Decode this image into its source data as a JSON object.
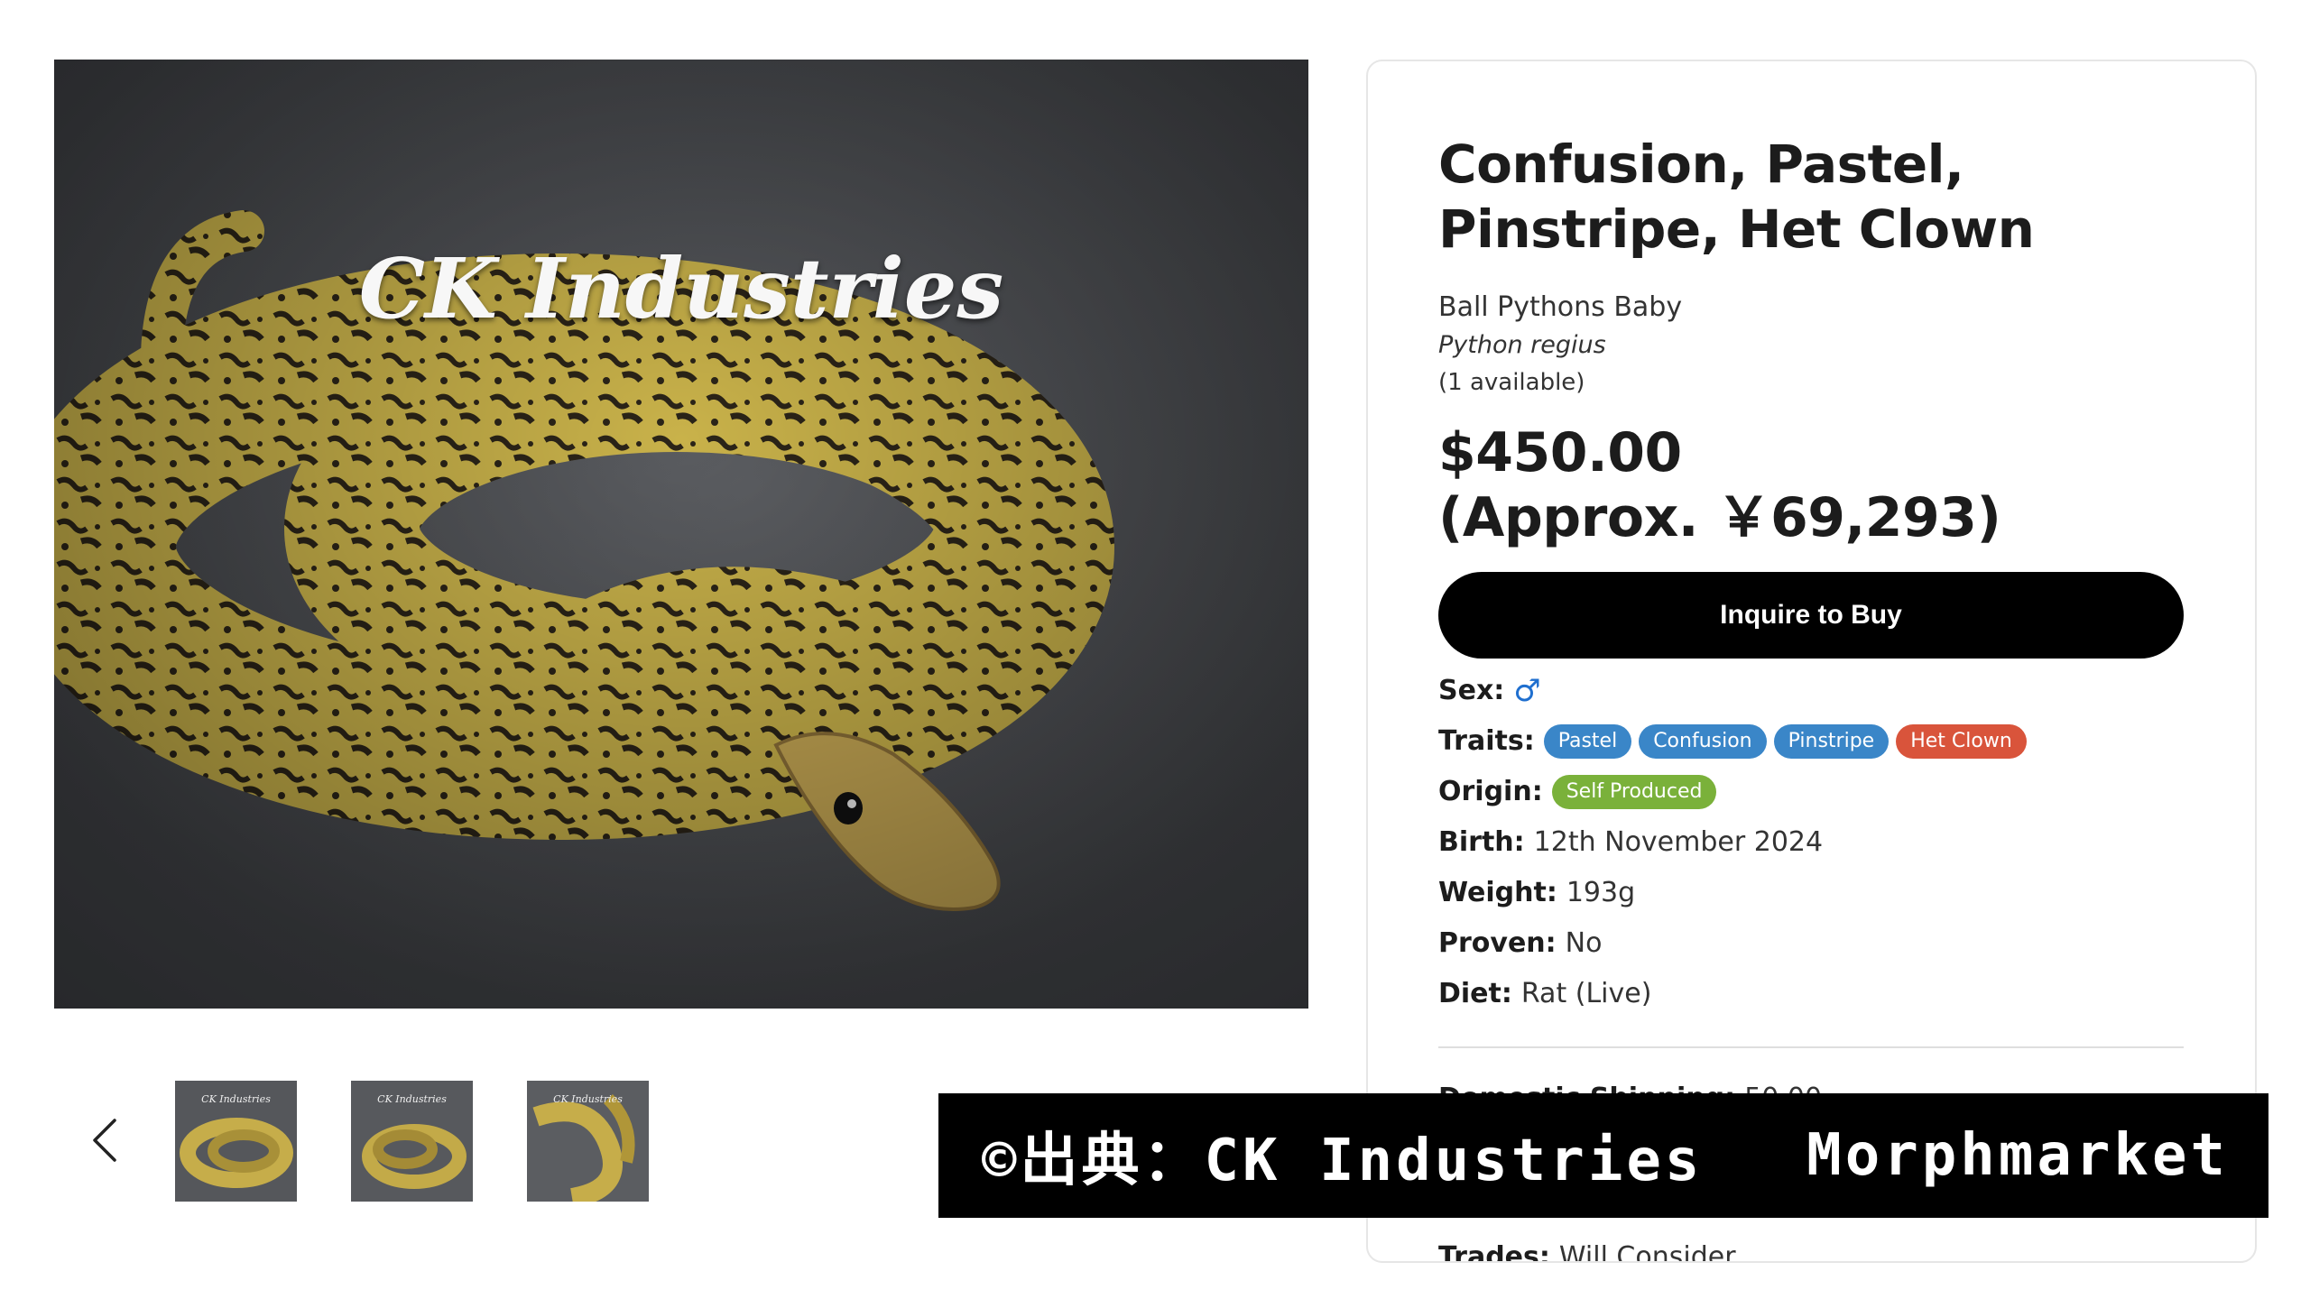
{
  "gallery": {
    "watermark": "CK Industries",
    "thumbnails": [
      {
        "label": "CK Industries"
      },
      {
        "label": "CK Industries"
      },
      {
        "label": "CK Industries"
      }
    ],
    "prev_icon": "chevron-left-icon"
  },
  "product": {
    "title": "Confusion, Pastel, Pinstripe, Het Clown",
    "category": "Ball Pythons Baby",
    "latin_name": "Python regius",
    "availability": "(1 available)",
    "price": "$450.00",
    "price_approx": "(Approx. ￥69,293)",
    "buy_label": "Inquire to Buy",
    "sex_label": "Sex:",
    "sex_icon": "male-icon",
    "sex_glyph": "♂",
    "traits_label": "Traits:",
    "traits": [
      {
        "name": "Pastel",
        "color": "#3a86c8"
      },
      {
        "name": "Confusion",
        "color": "#3a86c8"
      },
      {
        "name": "Pinstripe",
        "color": "#3a86c8"
      },
      {
        "name": "Het Clown",
        "color": "#d9543b"
      }
    ],
    "origin_label": "Origin:",
    "origin": {
      "name": "Self Produced",
      "color": "#7ab13a"
    },
    "birth_label": "Birth:",
    "birth": "12th November 2024",
    "weight_label": "Weight:",
    "weight": "193g",
    "proven_label": "Proven:",
    "proven": "No",
    "diet_label": "Diet:",
    "diet": "Rat (Live)",
    "shipping_label": "Domestic Shipping:",
    "shipping": "50.00",
    "trades_label": "Trades:",
    "trades": "Will Consider"
  },
  "banner": {
    "source": "©出典：CK Industries",
    "site": "Morphmarket"
  }
}
